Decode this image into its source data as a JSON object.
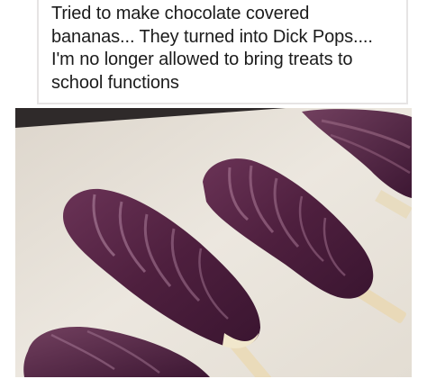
{
  "caption": {
    "text": "Tried to make chocolate covered\nbananas... They turned into Dick Pops....\nI'm no longer allowed to bring treats to\nschool functions"
  },
  "photo": {
    "subject": "chocolate-covered bananas on sticks",
    "colors": {
      "paper": "#e9e4dc",
      "chocolate": "#5a2a4a",
      "chocolate_highlight": "#8a5a7a",
      "banana": "#f3ead0",
      "stick": "#e9d9b8"
    }
  }
}
